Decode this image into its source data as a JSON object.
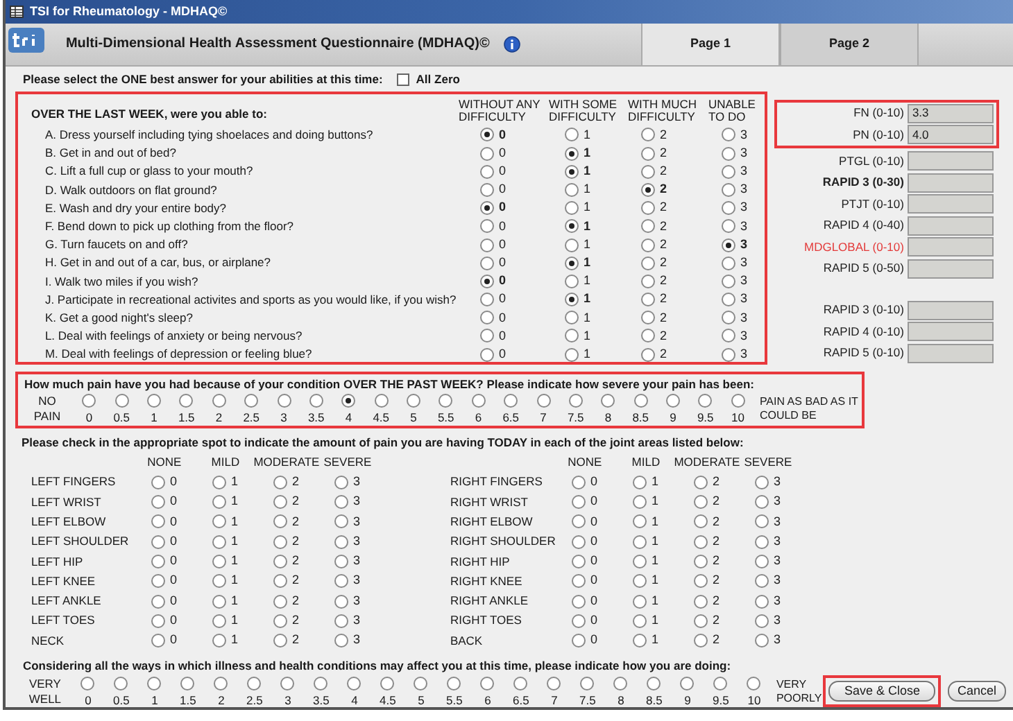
{
  "window": {
    "title": "TSI for Rheumatology - MDHAQ©"
  },
  "header": {
    "title": "Multi-Dimensional Health Assessment Questionnaire (MDHAQ)©"
  },
  "tabs": [
    {
      "label": "Page 1",
      "selected": true
    },
    {
      "label": "Page 2",
      "selected": false
    }
  ],
  "instruction": {
    "text": "Please select the ONE best answer for your abilities at this time:",
    "all_zero": {
      "label": "All Zero",
      "checked": false
    }
  },
  "function_section": {
    "heading": "OVER THE LAST WEEK, were you able to:",
    "columns": [
      "WITHOUT ANY DIFFICULTY",
      "WITH SOME DIFFICULTY",
      "WITH MUCH DIFFICULTY",
      "UNABLE TO DO"
    ],
    "questions": [
      {
        "text": "A. Dress yourself including tying shoelaces and doing buttons?",
        "options": [
          {
            "label": "0",
            "selected": true
          },
          {
            "label": "1",
            "selected": false
          },
          {
            "label": "2",
            "selected": false
          },
          {
            "label": "3",
            "selected": false
          }
        ]
      },
      {
        "text": "B. Get in and out of bed?",
        "options": [
          {
            "label": "0",
            "selected": false
          },
          {
            "label": "1",
            "selected": true
          },
          {
            "label": "2",
            "selected": false
          },
          {
            "label": "3",
            "selected": false
          }
        ]
      },
      {
        "text": "C. Lift a full cup or glass to your mouth?",
        "options": [
          {
            "label": "0",
            "selected": false
          },
          {
            "label": "1",
            "selected": true
          },
          {
            "label": "2",
            "selected": false
          },
          {
            "label": "3",
            "selected": false
          }
        ]
      },
      {
        "text": "D. Walk outdoors on flat ground?",
        "options": [
          {
            "label": "0",
            "selected": false
          },
          {
            "label": "1",
            "selected": false
          },
          {
            "label": "2",
            "selected": true
          },
          {
            "label": "3",
            "selected": false
          }
        ]
      },
      {
        "text": "E. Wash and dry your entire body?",
        "options": [
          {
            "label": "0",
            "selected": true
          },
          {
            "label": "1",
            "selected": false
          },
          {
            "label": "2",
            "selected": false
          },
          {
            "label": "3",
            "selected": false
          }
        ]
      },
      {
        "text": "F. Bend down to pick up clothing from the floor?",
        "options": [
          {
            "label": "0",
            "selected": false
          },
          {
            "label": "1",
            "selected": true
          },
          {
            "label": "2",
            "selected": false
          },
          {
            "label": "3",
            "selected": false
          }
        ]
      },
      {
        "text": "G. Turn faucets on and off?",
        "options": [
          {
            "label": "0",
            "selected": false
          },
          {
            "label": "1",
            "selected": false
          },
          {
            "label": "2",
            "selected": false
          },
          {
            "label": "3",
            "selected": true
          }
        ]
      },
      {
        "text": "H. Get in and out of a car, bus, or airplane?",
        "options": [
          {
            "label": "0",
            "selected": false
          },
          {
            "label": "1",
            "selected": true
          },
          {
            "label": "2",
            "selected": false
          },
          {
            "label": "3",
            "selected": false
          }
        ]
      },
      {
        "text": "I. Walk two miles if you wish?",
        "options": [
          {
            "label": "0",
            "selected": true
          },
          {
            "label": "1",
            "selected": false
          },
          {
            "label": "2",
            "selected": false
          },
          {
            "label": "3",
            "selected": false
          }
        ]
      },
      {
        "text": "J. Participate in recreational activites and sports as you would like, if you wish?",
        "options": [
          {
            "label": "0",
            "selected": false
          },
          {
            "label": "1",
            "selected": true
          },
          {
            "label": "2",
            "selected": false
          },
          {
            "label": "3",
            "selected": false
          }
        ]
      },
      {
        "text": "K. Get a good night's sleep?",
        "options": [
          {
            "label": "0",
            "selected": false
          },
          {
            "label": "1",
            "selected": false
          },
          {
            "label": "2",
            "selected": false
          },
          {
            "label": "3",
            "selected": false
          }
        ]
      },
      {
        "text": "L. Deal with feelings of anxiety or being nervous?",
        "options": [
          {
            "label": "0",
            "selected": false
          },
          {
            "label": "1",
            "selected": false
          },
          {
            "label": "2",
            "selected": false
          },
          {
            "label": "3",
            "selected": false
          }
        ]
      },
      {
        "text": "M. Deal with feelings of depression or feeling blue?",
        "options": [
          {
            "label": "0",
            "selected": false
          },
          {
            "label": "1",
            "selected": false
          },
          {
            "label": "2",
            "selected": false
          },
          {
            "label": "3",
            "selected": false
          }
        ]
      }
    ]
  },
  "score_groups": [
    {
      "highlighted": true,
      "fields": [
        {
          "label": "FN (0-10)",
          "value": "3.3",
          "kind": "normal"
        },
        {
          "label": "PN (0-10)",
          "value": "4.0",
          "kind": "normal"
        }
      ]
    },
    {
      "highlighted": false,
      "fields": [
        {
          "label": "PTGL (0-10)",
          "kind": "normal"
        },
        {
          "label": "RAPID 3 (0-30)",
          "kind": "bold"
        },
        {
          "label": "PTJT (0-10)",
          "kind": "normal"
        },
        {
          "label": "RAPID 4 (0-40)",
          "kind": "normal"
        },
        {
          "label": "MDGLOBAL (0-10)",
          "kind": "alert"
        },
        {
          "label": "RAPID 5 (0-50)",
          "kind": "normal"
        }
      ]
    },
    {
      "highlighted": false,
      "fields": [
        {
          "label": "RAPID 3 (0-10)",
          "kind": "normal"
        },
        {
          "label": "RAPID 4 (0-10)",
          "kind": "normal"
        },
        {
          "label": "RAPID 5 (0-10)",
          "kind": "normal"
        }
      ]
    }
  ],
  "pain_scale": {
    "question": "How much pain have you had because of your condition OVER THE PAST WEEK? Please indicate how severe your pain has been:",
    "low_label": "NO PAIN",
    "high_label": "PAIN AS BAD AS IT COULD BE",
    "options": [
      {
        "label": "0",
        "selected": false
      },
      {
        "label": "0.5",
        "selected": false
      },
      {
        "label": "1",
        "selected": false
      },
      {
        "label": "1.5",
        "selected": false
      },
      {
        "label": "2",
        "selected": false
      },
      {
        "label": "2.5",
        "selected": false
      },
      {
        "label": "3",
        "selected": false
      },
      {
        "label": "3.5",
        "selected": false
      },
      {
        "label": "4",
        "selected": true
      },
      {
        "label": "4.5",
        "selected": false
      },
      {
        "label": "5",
        "selected": false
      },
      {
        "label": "5.5",
        "selected": false
      },
      {
        "label": "6",
        "selected": false
      },
      {
        "label": "6.5",
        "selected": false
      },
      {
        "label": "7",
        "selected": false
      },
      {
        "label": "7.5",
        "selected": false
      },
      {
        "label": "8",
        "selected": false
      },
      {
        "label": "8.5",
        "selected": false
      },
      {
        "label": "9",
        "selected": false
      },
      {
        "label": "9.5",
        "selected": false
      },
      {
        "label": "10",
        "selected": false
      }
    ]
  },
  "joints": {
    "instruction": "Please check in the appropriate spot to indicate the amount of pain you are having TODAY in each of the joint areas listed below:",
    "left_columns": [
      "NONE",
      "MILD",
      "MODERATE",
      "SEVERE"
    ],
    "right_columns": [
      "NONE",
      "MILD",
      "MODERATE",
      "SEVERE"
    ],
    "left": [
      {
        "name": "LEFT FINGERS",
        "options": [
          {
            "label": "0",
            "selected": false
          },
          {
            "label": "1",
            "selected": false
          },
          {
            "label": "2",
            "selected": false
          },
          {
            "label": "3",
            "selected": false
          }
        ]
      },
      {
        "name": "LEFT WRIST",
        "options": [
          {
            "label": "0",
            "selected": false
          },
          {
            "label": "1",
            "selected": false
          },
          {
            "label": "2",
            "selected": false
          },
          {
            "label": "3",
            "selected": false
          }
        ]
      },
      {
        "name": "LEFT ELBOW",
        "options": [
          {
            "label": "0",
            "selected": false
          },
          {
            "label": "1",
            "selected": false
          },
          {
            "label": "2",
            "selected": false
          },
          {
            "label": "3",
            "selected": false
          }
        ]
      },
      {
        "name": "LEFT SHOULDER",
        "options": [
          {
            "label": "0",
            "selected": false
          },
          {
            "label": "1",
            "selected": false
          },
          {
            "label": "2",
            "selected": false
          },
          {
            "label": "3",
            "selected": false
          }
        ]
      },
      {
        "name": "LEFT HIP",
        "options": [
          {
            "label": "0",
            "selected": false
          },
          {
            "label": "1",
            "selected": false
          },
          {
            "label": "2",
            "selected": false
          },
          {
            "label": "3",
            "selected": false
          }
        ]
      },
      {
        "name": "LEFT KNEE",
        "options": [
          {
            "label": "0",
            "selected": false
          },
          {
            "label": "1",
            "selected": false
          },
          {
            "label": "2",
            "selected": false
          },
          {
            "label": "3",
            "selected": false
          }
        ]
      },
      {
        "name": "LEFT ANKLE",
        "options": [
          {
            "label": "0",
            "selected": false
          },
          {
            "label": "1",
            "selected": false
          },
          {
            "label": "2",
            "selected": false
          },
          {
            "label": "3",
            "selected": false
          }
        ]
      },
      {
        "name": "LEFT TOES",
        "options": [
          {
            "label": "0",
            "selected": false
          },
          {
            "label": "1",
            "selected": false
          },
          {
            "label": "2",
            "selected": false
          },
          {
            "label": "3",
            "selected": false
          }
        ]
      },
      {
        "name": "NECK",
        "options": [
          {
            "label": "0",
            "selected": false
          },
          {
            "label": "1",
            "selected": false
          },
          {
            "label": "2",
            "selected": false
          },
          {
            "label": "3",
            "selected": false
          }
        ]
      }
    ],
    "right": [
      {
        "name": "RIGHT FINGERS",
        "options": [
          {
            "label": "0",
            "selected": false
          },
          {
            "label": "1",
            "selected": false
          },
          {
            "label": "2",
            "selected": false
          },
          {
            "label": "3",
            "selected": false
          }
        ]
      },
      {
        "name": "RIGHT WRIST",
        "options": [
          {
            "label": "0",
            "selected": false
          },
          {
            "label": "1",
            "selected": false
          },
          {
            "label": "2",
            "selected": false
          },
          {
            "label": "3",
            "selected": false
          }
        ]
      },
      {
        "name": "RIGHT ELBOW",
        "options": [
          {
            "label": "0",
            "selected": false
          },
          {
            "label": "1",
            "selected": false
          },
          {
            "label": "2",
            "selected": false
          },
          {
            "label": "3",
            "selected": false
          }
        ]
      },
      {
        "name": "RIGHT SHOULDER",
        "options": [
          {
            "label": "0",
            "selected": false
          },
          {
            "label": "1",
            "selected": false
          },
          {
            "label": "2",
            "selected": false
          },
          {
            "label": "3",
            "selected": false
          }
        ]
      },
      {
        "name": "RIGHT HIP",
        "options": [
          {
            "label": "0",
            "selected": false
          },
          {
            "label": "1",
            "selected": false
          },
          {
            "label": "2",
            "selected": false
          },
          {
            "label": "3",
            "selected": false
          }
        ]
      },
      {
        "name": "RIGHT KNEE",
        "options": [
          {
            "label": "0",
            "selected": false
          },
          {
            "label": "1",
            "selected": false
          },
          {
            "label": "2",
            "selected": false
          },
          {
            "label": "3",
            "selected": false
          }
        ]
      },
      {
        "name": "RIGHT ANKLE",
        "options": [
          {
            "label": "0",
            "selected": false
          },
          {
            "label": "1",
            "selected": false
          },
          {
            "label": "2",
            "selected": false
          },
          {
            "label": "3",
            "selected": false
          }
        ]
      },
      {
        "name": "RIGHT TOES",
        "options": [
          {
            "label": "0",
            "selected": false
          },
          {
            "label": "1",
            "selected": false
          },
          {
            "label": "2",
            "selected": false
          },
          {
            "label": "3",
            "selected": false
          }
        ]
      },
      {
        "name": "BACK",
        "options": [
          {
            "label": "0",
            "selected": false
          },
          {
            "label": "1",
            "selected": false
          },
          {
            "label": "2",
            "selected": false
          },
          {
            "label": "3",
            "selected": false
          }
        ]
      }
    ]
  },
  "global_scale": {
    "question": "Considering all the ways in which illness and health conditions may affect you at this time, please indicate how you are doing:",
    "low_label": "VERY WELL",
    "high_label": "VERY POORLY",
    "options": [
      {
        "label": "0",
        "selected": false
      },
      {
        "label": "0.5",
        "selected": false
      },
      {
        "label": "1",
        "selected": false
      },
      {
        "label": "1.5",
        "selected": false
      },
      {
        "label": "2",
        "selected": false
      },
      {
        "label": "2.5",
        "selected": false
      },
      {
        "label": "3",
        "selected": false
      },
      {
        "label": "3.5",
        "selected": false
      },
      {
        "label": "4",
        "selected": false
      },
      {
        "label": "4.5",
        "selected": false
      },
      {
        "label": "5",
        "selected": false
      },
      {
        "label": "5.5",
        "selected": false
      },
      {
        "label": "6",
        "selected": false
      },
      {
        "label": "6.5",
        "selected": false
      },
      {
        "label": "7",
        "selected": false
      },
      {
        "label": "7.5",
        "selected": false
      },
      {
        "label": "8",
        "selected": false
      },
      {
        "label": "8.5",
        "selected": false
      },
      {
        "label": "9",
        "selected": false
      },
      {
        "label": "9.5",
        "selected": false
      },
      {
        "label": "10",
        "selected": false
      }
    ]
  },
  "buttons": [
    {
      "label": "Save & Close",
      "highlighted": true
    },
    {
      "label": "Cancel",
      "highlighted": false
    }
  ]
}
